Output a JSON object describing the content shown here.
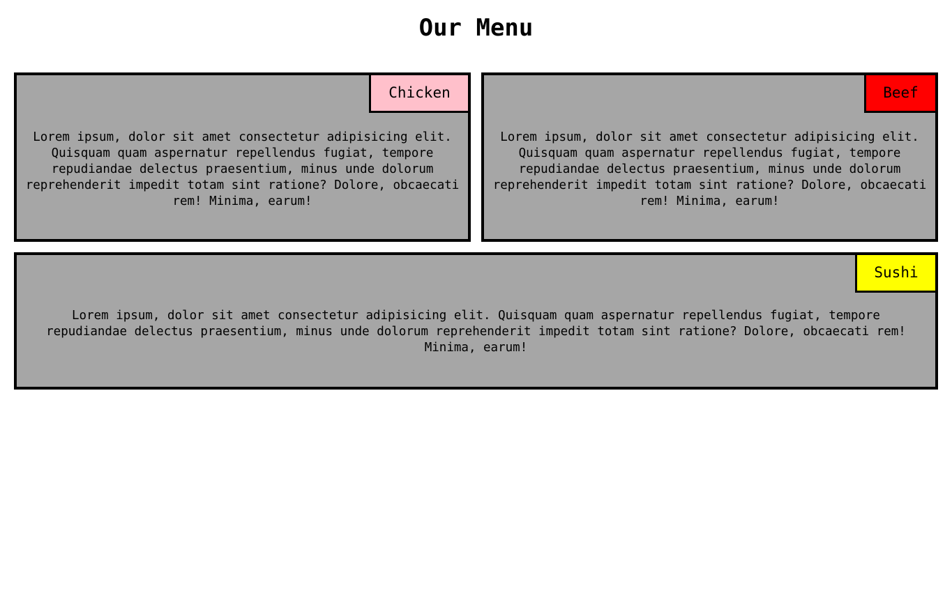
{
  "page": {
    "title": "Our Menu"
  },
  "menu": {
    "items": [
      {
        "label": "Chicken",
        "tag_color": "#ffc0cb",
        "description": "Lorem ipsum, dolor sit amet consectetur adipisicing elit. Quisquam quam aspernatur repellendus fugiat, tempore repudiandae delectus praesentium, minus unde dolorum reprehenderit impedit totam sint ratione? Dolore, obcaecati rem! Minima, earum!"
      },
      {
        "label": "Beef",
        "tag_color": "#ff0000",
        "description": "Lorem ipsum, dolor sit amet consectetur adipisicing elit. Quisquam quam aspernatur repellendus fugiat, tempore repudiandae delectus praesentium, minus unde dolorum reprehenderit impedit totam sint ratione? Dolore, obcaecati rem! Minima, earum!"
      },
      {
        "label": "Sushi",
        "tag_color": "#ffff00",
        "description": "Lorem ipsum, dolor sit amet consectetur adipisicing elit. Quisquam quam aspernatur repellendus fugiat, tempore repudiandae delectus praesentium, minus unde dolorum reprehenderit impedit totam sint ratione? Dolore, obcaecati rem! Minima, earum!"
      }
    ]
  },
  "colors": {
    "card_background": "#a6a6a6",
    "border": "#000000",
    "page_background": "#ffffff"
  }
}
